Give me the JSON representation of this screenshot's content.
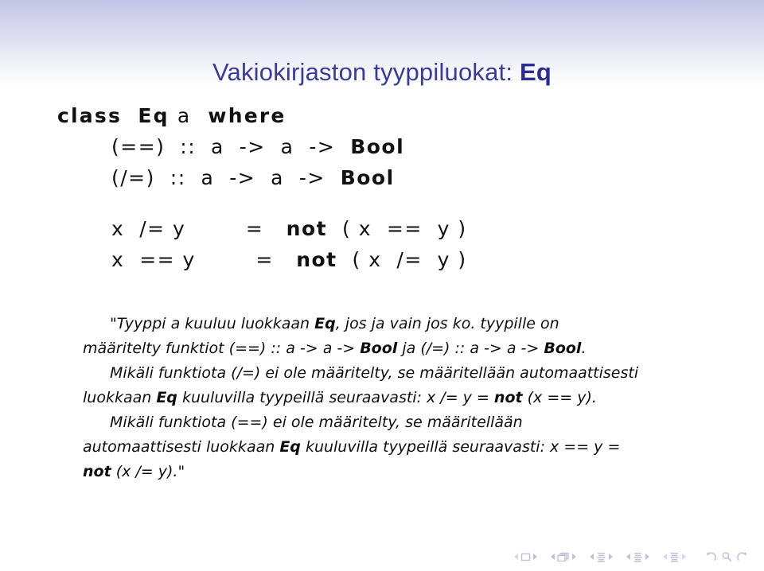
{
  "slide": {
    "title_main": "Vakiokirjaston tyyppiluokat: ",
    "title_accent": "Eq",
    "background_top_color": "#c3c3e6",
    "title_color": "#3b3b9e"
  },
  "code_block_class": {
    "lines": [
      {
        "id": "line-class-decl",
        "indent": "ind0",
        "segments": [
          {
            "text": "class",
            "style": "kw"
          },
          {
            "text": "  ",
            "style": "plain"
          },
          {
            "text": "Eq",
            "style": "ty"
          },
          {
            "text": " a ",
            "style": "plain"
          },
          {
            "text": " where",
            "style": "kw"
          }
        ]
      },
      {
        "id": "line-eq-sig",
        "indent": "ind1",
        "segments": [
          {
            "text": "(==)  ::  a  ",
            "style": "plain"
          },
          {
            "text": "->",
            "style": "plain"
          },
          {
            "text": "  a  ",
            "style": "plain"
          },
          {
            "text": "->",
            "style": "plain"
          },
          {
            "text": "  ",
            "style": "plain"
          },
          {
            "text": "Bool",
            "style": "ty"
          }
        ]
      },
      {
        "id": "line-neq-sig",
        "indent": "ind2",
        "segments": [
          {
            "text": "(/=)  ::  a  ",
            "style": "plain"
          },
          {
            "text": "->",
            "style": "plain"
          },
          {
            "text": "  a  ",
            "style": "plain"
          },
          {
            "text": "->",
            "style": "plain"
          },
          {
            "text": "  ",
            "style": "plain"
          },
          {
            "text": "Bool",
            "style": "ty"
          }
        ]
      }
    ]
  },
  "code_block_defs": {
    "lines": [
      {
        "id": "line-neq-def",
        "indent": "ind1",
        "segments": [
          {
            "text": "x  /= y        =   ",
            "style": "plain"
          },
          {
            "text": "not",
            "style": "fn"
          },
          {
            "text": "  ( x  ==  y )",
            "style": "plain"
          }
        ]
      },
      {
        "id": "line-eq-def",
        "indent": "ind2",
        "segments": [
          {
            "text": "x  == y        =   ",
            "style": "plain"
          },
          {
            "text": "not",
            "style": "fn"
          },
          {
            "text": "  ( x  /=  y )",
            "style": "plain"
          }
        ]
      }
    ]
  },
  "quote_body": {
    "paragraphs": [
      {
        "id": "quote-para-1",
        "indented": true,
        "segments": [
          {
            "text": "\"Tyyppi a kuuluu luokkaan ",
            "style": "plain"
          },
          {
            "text": "Eq",
            "style": "bold"
          },
          {
            "text": ", jos ja vain jos ko. tyypille on määritelty funktiot (==) :: a -> a -> ",
            "style": "plain"
          },
          {
            "text": "Bool",
            "style": "bold"
          },
          {
            "text": " ja (/=) :: a -> a -> ",
            "style": "plain"
          },
          {
            "text": "Bool",
            "style": "bold"
          },
          {
            "text": ".",
            "style": "plain"
          }
        ]
      },
      {
        "id": "quote-para-2",
        "indented": true,
        "segments": [
          {
            "text": "Mikäli funktiota (/=) ei ole määritelty, se määritellään automaattisesti luokkaan ",
            "style": "plain"
          },
          {
            "text": "Eq",
            "style": "bold"
          },
          {
            "text": " kuuluvilla tyypeillä seuraavasti: x /= y = ",
            "style": "plain"
          },
          {
            "text": "not",
            "style": "bold"
          },
          {
            "text": " (x == y).",
            "style": "plain"
          }
        ]
      },
      {
        "id": "quote-para-3",
        "indented": true,
        "segments": [
          {
            "text": "Mikäli funktiota (==) ei ole määritelty, se määritellään automaattisesti luokkaan ",
            "style": "plain"
          },
          {
            "text": "Eq",
            "style": "bold"
          },
          {
            "text": " kuuluvilla tyypeillä seuraavasti: x == y = ",
            "style": "plain"
          },
          {
            "text": "not",
            "style": "bold"
          },
          {
            "text": " (x /= y).\"",
            "style": "plain"
          }
        ]
      }
    ]
  },
  "navigation": {
    "color": "#a9a9cf",
    "groups": [
      {
        "name": "nav-group-frame",
        "icon": "frame-icon",
        "prev": false,
        "next": true
      },
      {
        "name": "nav-group-subsection",
        "icon": "stacked-frames-icon",
        "prev": true,
        "next": true
      },
      {
        "name": "nav-group-section",
        "icon": "section-lines-icon",
        "prev": true,
        "next": true
      },
      {
        "name": "nav-group-part",
        "icon": "section-lines-icon",
        "prev": true,
        "next": true
      },
      {
        "name": "nav-group-presentation",
        "icon": "section-lines-icon",
        "prev": false,
        "next": false
      }
    ],
    "actions": [
      {
        "name": "nav-back-button",
        "icon": "back-arrow-icon"
      },
      {
        "name": "nav-search-button",
        "icon": "search-icon"
      },
      {
        "name": "nav-forward-button",
        "icon": "forward-arrow-icon"
      }
    ]
  }
}
